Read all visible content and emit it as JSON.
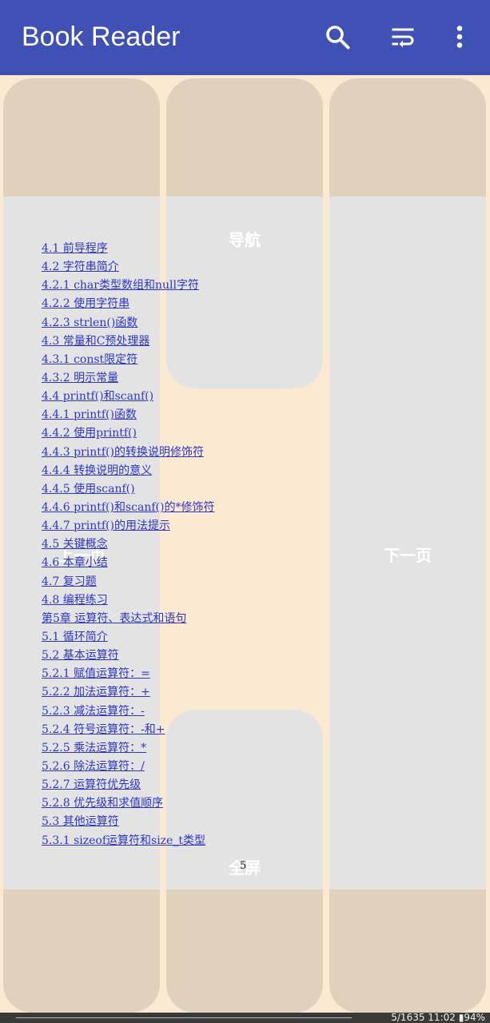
{
  "app": {
    "title": "Book Reader"
  },
  "icons": [
    "search-icon",
    "wrap-icon",
    "more-vert-icon"
  ],
  "zones": {
    "top_center": "导航",
    "middle_left": "上一页",
    "middle_right": "下一页",
    "bottom_center": "全屏"
  },
  "toc": [
    "4.1 前导程序",
    "4.2 字符串简介",
    "4.2.1 char类型数组和null字符",
    "4.2.2 使用字符串",
    "4.2.3 strlen()函数",
    "4.3 常量和C预处理器",
    "4.3.1 const限定符",
    "4.3.2 明示常量",
    "4.4 printf()和scanf()",
    "4.4.1 printf()函数",
    "4.4.2 使用printf()",
    "4.4.3 printf()的转换说明修饰符",
    "4.4.4 转换说明的意义",
    "4.4.5 使用scanf()",
    "4.4.6 printf()和scanf()的*修饰符",
    "4.4.7 printf()的用法提示",
    "4.5 关键概念",
    "4.6 本章小结",
    "4.7 复习题",
    "4.8 编程练习",
    "第5章 运算符、表达式和语句",
    "5.1 循环简介",
    "5.2 基本运算符",
    "5.2.1 赋值运算符：=",
    "5.2.2 加法运算符：+",
    "5.2.3 减法运算符：-",
    "5.2.4 符号运算符：-和+",
    "5.2.5 乘法运算符：*",
    "5.2.6 除法运算符：/",
    "5.2.7 运算符优先级",
    "5.2.8 优先级和求值顺序",
    "5.3 其他运算符",
    "5.3.1 sizeof运算符和size_t类型"
  ],
  "page_number": "5",
  "status": {
    "progress": "5/1635",
    "time": "11:02",
    "battery": "94%"
  },
  "colors": {
    "appbar": "#3f51b5",
    "link": "#2d36c9",
    "page_bg": "#fbe9d2"
  }
}
